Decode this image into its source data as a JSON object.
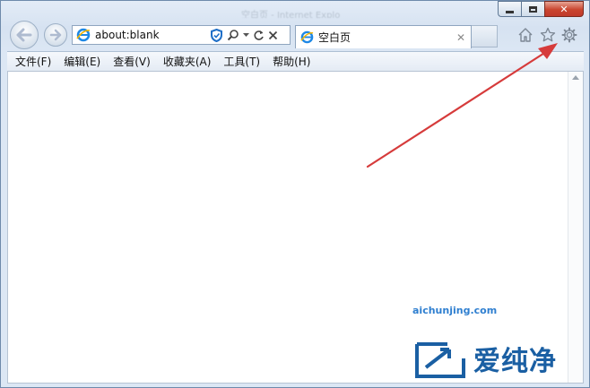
{
  "window": {
    "title": "空白页 - Internet Explorer"
  },
  "caption": {
    "min": "",
    "max": "",
    "close": "✕"
  },
  "address_bar": {
    "url": "about:blank"
  },
  "tab": {
    "label": "空白页",
    "close": "✕"
  },
  "menu": [
    "文件(F)",
    "编辑(E)",
    "查看(V)",
    "收藏夹(A)",
    "工具(T)",
    "帮助(H)"
  ],
  "icons": {
    "back": "arrow-left-icon",
    "forward": "arrow-right-icon",
    "page": "ie-logo-icon",
    "shield": "shield-icon",
    "search": "search-icon",
    "dropdown": "dropdown-arrow-icon",
    "refresh": "refresh-icon",
    "stop": "stop-icon",
    "home": "home-icon",
    "favorites": "star-icon",
    "tools": "gear-icon"
  },
  "colors": {
    "annotation_arrow": "#d63b3b",
    "accent": "#1a5fa3"
  },
  "watermark": {
    "name": "爱纯净",
    "url": "aichunjing.com"
  }
}
